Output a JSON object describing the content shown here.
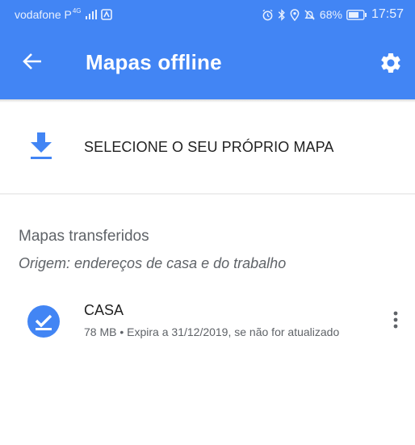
{
  "status_bar": {
    "carrier": "vodafone P",
    "network_type": "4G",
    "battery_percent": "68%",
    "time": "17:57",
    "icons": [
      "signal-icon",
      "map-notification-icon",
      "alarm-icon",
      "bluetooth-icon",
      "location-icon",
      "mute-icon",
      "battery-icon"
    ]
  },
  "app_bar": {
    "title": "Mapas offline",
    "back_icon": "arrow-back-icon",
    "settings_icon": "gear-icon",
    "color": "#4285f4"
  },
  "select_own_map": {
    "label": "SELECIONE O SEU PRÓPRIO MAPA",
    "icon": "download-icon",
    "icon_color": "#4285f4"
  },
  "downloaded_maps": {
    "title": "Mapas transferidos",
    "subtitle": "Origem: endereços de casa e do trabalho",
    "items": [
      {
        "name": "CASA",
        "size": "78 MB",
        "expiry": "Expira a 31/12/2019, se não for atualizado",
        "status_icon": "check-circle-icon",
        "menu_icon": "more-vert-icon"
      }
    ]
  }
}
